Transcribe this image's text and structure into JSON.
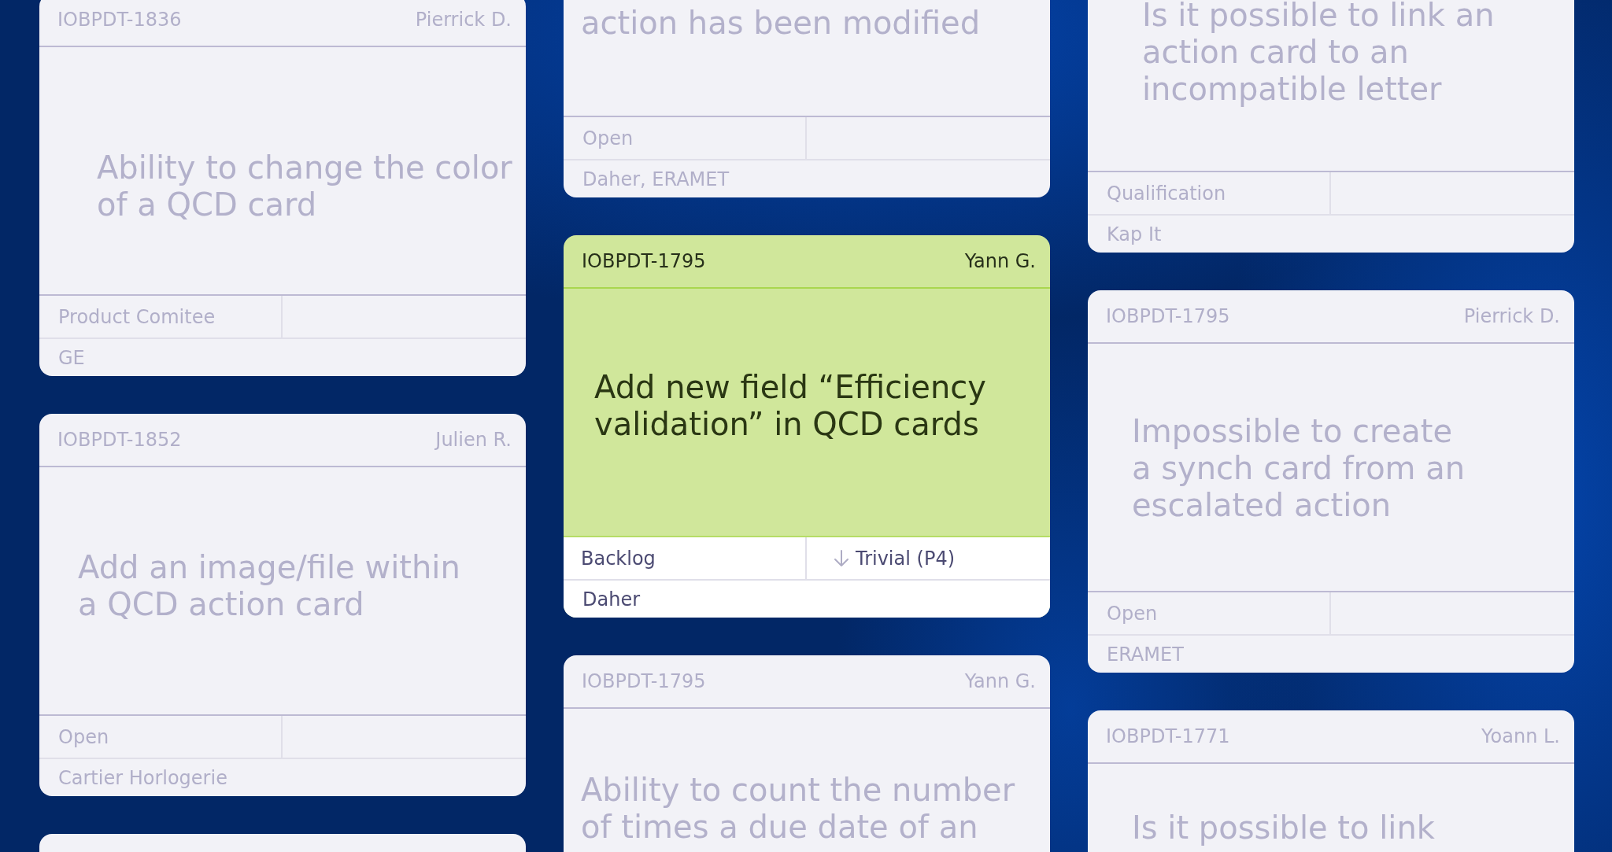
{
  "columns": [
    {
      "cards": [
        {
          "id": "IOBPDT-1836",
          "assignee": "Pierrick D.",
          "title": "Ability to change the color of a QCD card",
          "status": "Product Comitee",
          "client": "GE",
          "selected": false
        },
        {
          "id": "IOBPDT-1852",
          "assignee": "Julien R.",
          "title": "Add an image/file within a QCD action card",
          "status": "Open",
          "client": "Cartier Horlogerie",
          "selected": false
        },
        {
          "selected": false
        }
      ]
    },
    {
      "cards": [
        {
          "title": "action has been modified",
          "status": "Open",
          "client": "Daher, ERAMET",
          "selected": false
        },
        {
          "id": "IOBPDT-1795",
          "assignee": "Yann G.",
          "title": "Add new field “Efficiency validation” in QCD cards",
          "status": "Backlog",
          "priority": "Trivial (P4)",
          "client": "Daher",
          "selected": true
        },
        {
          "id": "IOBPDT-1795",
          "assignee": "Yann G.",
          "title": "Ability to count the number of times a due date of an",
          "selected": false
        }
      ]
    },
    {
      "cards": [
        {
          "title": "Is it possible to link an action card to an incompatible letter",
          "status": "Qualification",
          "client": "Kap It",
          "selected": false
        },
        {
          "id": "IOBPDT-1795",
          "assignee": "Pierrick D.",
          "title": "Impossible to create a synch card from an escalated action",
          "status": "Open",
          "client": "ERAMET",
          "selected": false
        },
        {
          "id": "IOBPDT-1771",
          "assignee": "Yoann L.",
          "title": "Is it possible to link",
          "selected": false
        }
      ]
    }
  ]
}
